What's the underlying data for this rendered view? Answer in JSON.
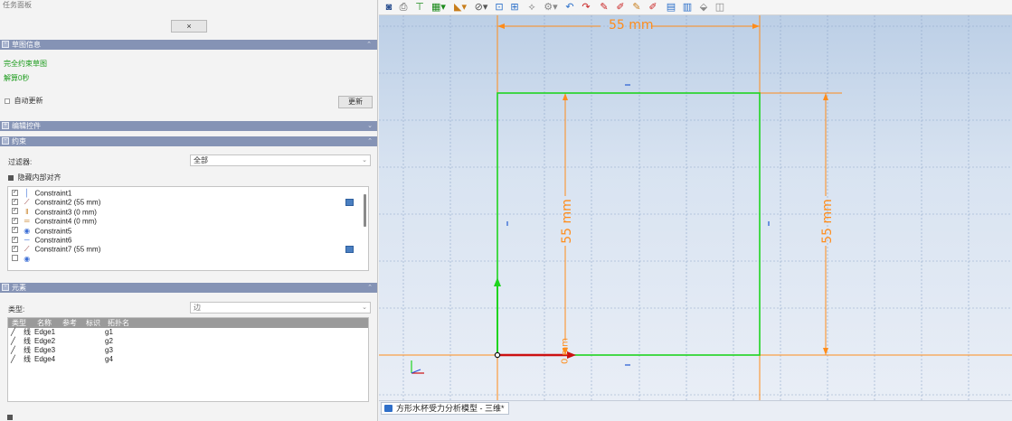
{
  "panel": {
    "title": "任务面板",
    "close_label": "×"
  },
  "sketch_info": {
    "header": "草图信息",
    "status": "完全约束草图",
    "solve_time": "解算0秒",
    "auto_update_label": "自动更新",
    "update_button": "更新"
  },
  "edit_controls": {
    "header": "编辑控件"
  },
  "constraints": {
    "header": "约束",
    "filter_label": "过滤器:",
    "filter_value": "全部",
    "hide_internal_label": "隐藏内部对齐",
    "items": [
      {
        "label": "Constraint1",
        "icon": "vertical-icon",
        "expr": false
      },
      {
        "label": "Constraint2 (55 mm)",
        "icon": "distance-icon",
        "expr": true
      },
      {
        "label": "Constraint3 (0 mm)",
        "icon": "distance-y-icon",
        "expr": false
      },
      {
        "label": "Constraint4 (0 mm)",
        "icon": "distance-x-icon",
        "expr": false
      },
      {
        "label": "Constraint5",
        "icon": "coincident-icon",
        "expr": false
      },
      {
        "label": "Constraint6",
        "icon": "horizontal-icon",
        "expr": false
      },
      {
        "label": "Constraint7 (55 mm)",
        "icon": "distance-icon",
        "expr": true
      }
    ]
  },
  "elements": {
    "header": "元素",
    "type_label": "类型:",
    "type_value": "边",
    "columns": [
      "类型",
      "名称",
      "参考",
      "标识",
      "拓扑名"
    ],
    "rows": [
      {
        "type": "线",
        "name": "Edge1",
        "topo": "g1"
      },
      {
        "type": "线",
        "name": "Edge2",
        "topo": "g2"
      },
      {
        "type": "线",
        "name": "Edge3",
        "topo": "g3"
      },
      {
        "type": "线",
        "name": "Edge4",
        "topo": "g4"
      }
    ]
  },
  "viewport": {
    "dim_top": "55 mm",
    "dim_inner": "55 mm",
    "dim_right": "55 mm",
    "dim_zero": "0 mm"
  },
  "status": {
    "tab_label": "方形水杯受力分析模型 - 三维*"
  },
  "colors": {
    "sketch_green": "#1fd41f",
    "dimension_orange": "#ff8c1a",
    "constraint_blue": "#3d6fd6",
    "axis_red": "#cc1111"
  }
}
